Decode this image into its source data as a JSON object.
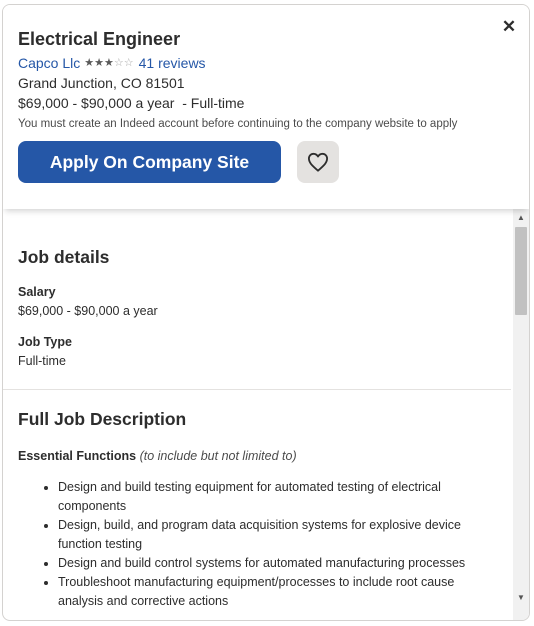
{
  "header": {
    "title": "Electrical Engineer",
    "company": "Capco Llc",
    "rating": 3,
    "rating_max": 5,
    "reviews": "41 reviews",
    "location": "Grand Junction, CO 81501",
    "salary_line": "$69,000 - $90,000 a year  - Full-time",
    "notice": "You must create an Indeed account before continuing to the company website to apply",
    "apply_label": "Apply On Company Site",
    "close_icon": "close-icon",
    "save_icon": "heart-icon",
    "accent_color": "#2557a7"
  },
  "job_details": {
    "heading": "Job details",
    "salary_label": "Salary",
    "salary_value": "$69,000 - $90,000 a year",
    "type_label": "Job Type",
    "type_value": "Full-time"
  },
  "description": {
    "heading": "Full Job Description",
    "essential_label": "Essential Functions",
    "essential_note": "(to include but not limited to)",
    "bullets": [
      "Design and build testing equipment for automated testing of electrical components",
      "Design, build, and program data acquisition systems for explosive device function testing",
      "Design and build control systems for automated manufacturing processes",
      "Troubleshoot manufacturing equipment/processes to include root cause analysis and corrective actions"
    ]
  }
}
